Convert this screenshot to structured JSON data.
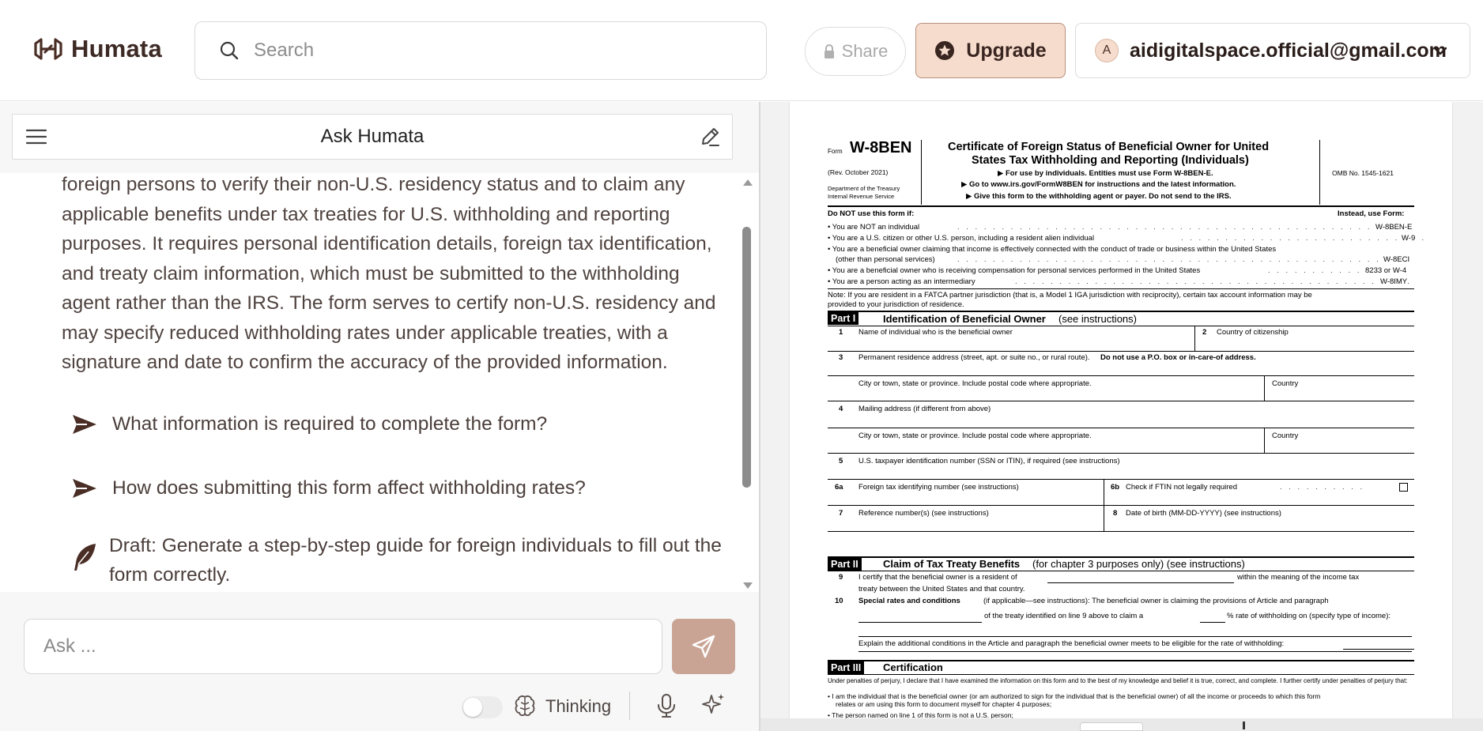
{
  "header": {
    "logo_text": "Humata",
    "search_placeholder": "Search",
    "share_label": "Share",
    "upgrade_label": "Upgrade",
    "account_initial": "A",
    "account_email": "aidigitalspace.official@gmail.com"
  },
  "chat": {
    "panel_title": "Ask Humata",
    "answer_text": "foreign persons to verify their non-U.S. residency status and to claim any applicable benefits under tax treaties for U.S. withholding and reporting purposes. It requires personal identification details, foreign tax identification, and treaty claim information, which must be submitted to the withholding agent rather than the IRS. The form serves to certify non-U.S. residency and may specify reduced withholding rates under applicable treaties, with a signature and date to confirm the accuracy of the provided information.",
    "suggestions": [
      "What information is required to complete the form?",
      "How does submitting this form affect withholding rates?"
    ],
    "draft_text": "Draft: Generate a step-by-step guide for foreign individuals to fill out the form correctly.",
    "input_placeholder": "Ask ...",
    "thinking_label": "Thinking",
    "thinking_enabled": false
  },
  "document": {
    "form_prefix": "Form",
    "form_name": "W-8BEN",
    "rev": "(Rev. October  2021)",
    "dept": "Department of the Treasury",
    "irs": "Internal Revenue Service",
    "title1": "Certificate of Foreign Status of Beneficial Owner for United",
    "title2": "States Tax Withholding and Reporting (Individuals)",
    "sub1": "▶ For use by individuals. Entities must use Form W-8BEN-E.",
    "sub2": "▶ Go to www.irs.gov/FormW8BEN for instructions and the latest information.",
    "sub3": "▶ Give this form to the withholding agent or payer. Do not send to the IRS.",
    "omb": "OMB No. 1545-1621",
    "do_not_use": "Do NOT use this form if:",
    "instead_use": "Instead, use Form:",
    "bullets": [
      {
        "text": "• You are NOT an individual",
        "form": "W-8BEN-E"
      },
      {
        "text": "• You are a U.S. citizen or other U.S. person, including a resident alien individual",
        "form": "W-9"
      },
      {
        "text": "• You are a beneficial owner claiming that income is effectively connected with the conduct of trade or business within the United States",
        "form": ""
      },
      {
        "text": "(other than personal services)",
        "form": "W-8ECI"
      },
      {
        "text": "• You are a beneficial owner who is receiving compensation for personal services performed in the United States",
        "form": "8233 or W-4"
      },
      {
        "text": "• You are a person acting as an intermediary",
        "form": "W-8IMY"
      }
    ],
    "note1": "Note: If you are resident in a FATCA partner jurisdiction (that is, a Model 1 IGA jurisdiction with reciprocity), certain tax account information may be",
    "note2": "provided to your jurisdiction of residence.",
    "part1_label": "Part I",
    "part1_title": "Identification of Beneficial Owner",
    "part1_suffix": "(see instructions)",
    "l1": "Name of individual who is the beneficial owner",
    "l2": "Country of citizenship",
    "l3": "Permanent residence address (street, apt. or suite no., or rural route).",
    "l3b": "Do not use a P.O. box or in-care-of address.",
    "city": "City or town, state or province. Include postal code where appropriate.",
    "country": "Country",
    "l4": "Mailing address (if different from above)",
    "l5": "U.S. taxpayer identification number (SSN or ITIN), if required (see instructions)",
    "l6a": "Foreign tax identifying number (see instructions)",
    "l6b": "Check if FTIN not legally required",
    "l7": "Reference number(s) (see instructions)",
    "l8": "Date of birth (MM-DD-YYYY) (see instructions)",
    "part2_label": "Part II",
    "part2_title": "Claim of Tax Treaty Benefits",
    "part2_suffix": "(for chapter 3 purposes only) (see instructions)",
    "l9a": "I certify that the beneficial owner is a resident of",
    "l9b": "within the meaning of the income tax",
    "l9c": "treaty between the United States and that country.",
    "l10a": "Special rates and conditions",
    "l10b": "(if applicable—see instructions): The beneficial owner is claiming the provisions of Article and paragraph",
    "l10c": "of the treaty identified on line 9 above to claim a",
    "l10d": "% rate of withholding on (specify type of income):",
    "l10e": "Explain the additional conditions in the Article and paragraph the beneficial owner meets to be eligible for the rate of withholding:",
    "part3_label": "Part III",
    "part3_title": "Certification",
    "cert1": "Under penalties of perjury, I declare that I have examined the information on this form and to the best of my knowledge and belief it is true, correct, and complete. I further certify under penalties of perjury that:",
    "cert2": "•  I am the individual that is the beneficial owner (or am authorized to sign for the individual that is the beneficial owner) of all the income or proceeds to which this form",
    "cert3": "relates or am using this form to document myself for chapter 4 purposes;",
    "cert4": "•  The person named on line 1 of this form is not a U.S. person;"
  }
}
